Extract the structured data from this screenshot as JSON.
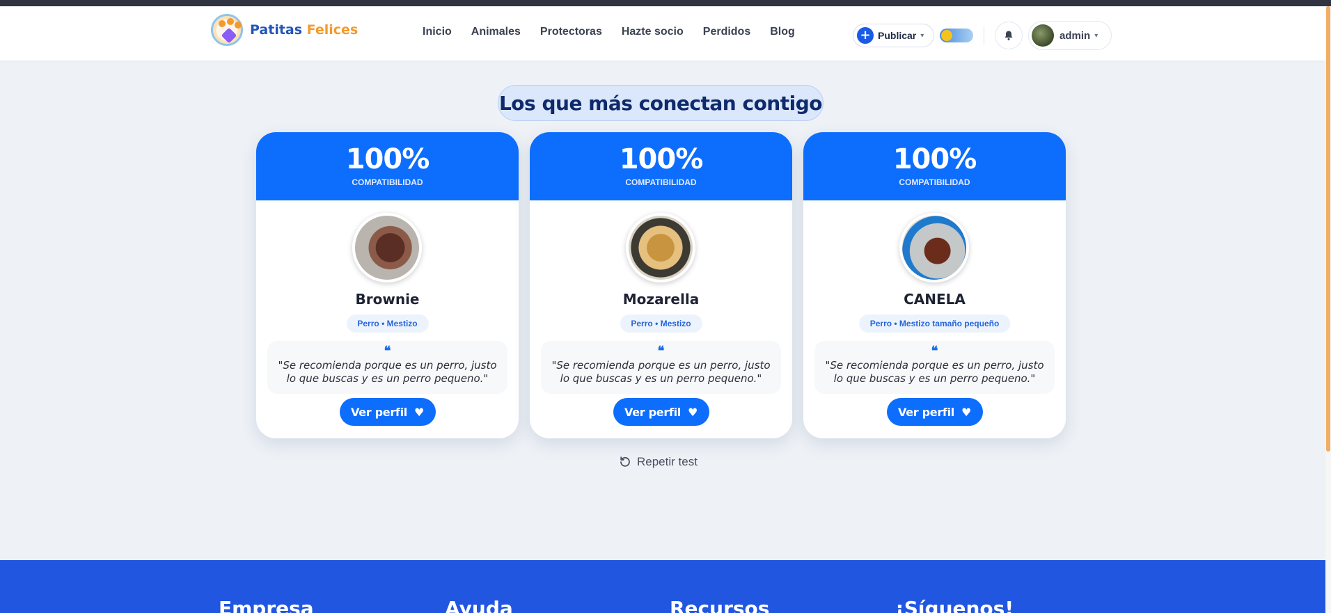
{
  "brand": {
    "name_part1": "Patitas",
    "name_part2": "Felices"
  },
  "nav": {
    "items": [
      "Inicio",
      "Animales",
      "Protectoras",
      "Hazte socio",
      "Perdidos",
      "Blog"
    ]
  },
  "header": {
    "publish_label": "Publicar",
    "user_label": "admin"
  },
  "section": {
    "title": "Los que más conectan contigo"
  },
  "cards": [
    {
      "percent": "100%",
      "compat_label": "COMPATIBILIDAD",
      "name": "Brownie",
      "tag": "Perro • Mestizo",
      "quote": "\"Se recomienda porque es un perro, justo lo que buscas y es un perro pequeno.\"",
      "button": "Ver perfil"
    },
    {
      "percent": "100%",
      "compat_label": "COMPATIBILIDAD",
      "name": "Mozarella",
      "tag": "Perro • Mestizo",
      "quote": "\"Se recomienda porque es un perro, justo lo que buscas y es un perro pequeno.\"",
      "button": "Ver perfil"
    },
    {
      "percent": "100%",
      "compat_label": "COMPATIBILIDAD",
      "name": "CANELA",
      "tag": "Perro • Mestizo tamaño pequeño",
      "quote": "\"Se recomienda porque es un perro, justo lo que buscas y es un perro pequeno.\"",
      "button": "Ver perfil"
    }
  ],
  "repeat_label": "Repetir test",
  "footer": {
    "columns": [
      "Empresa",
      "Ayuda",
      "Recursos",
      "¡Síguenos!"
    ]
  },
  "colors": {
    "primary": "#0d6efd",
    "brand_blue": "#2454b8",
    "brand_orange": "#f39a2f",
    "footer": "#2056e0"
  },
  "icons": {
    "publish": "plus-circle-icon",
    "theme": "theme-toggle-icon",
    "notifications": "bell-icon",
    "profile_button": "heart-icon",
    "repeat": "rotate-ccw-icon"
  }
}
